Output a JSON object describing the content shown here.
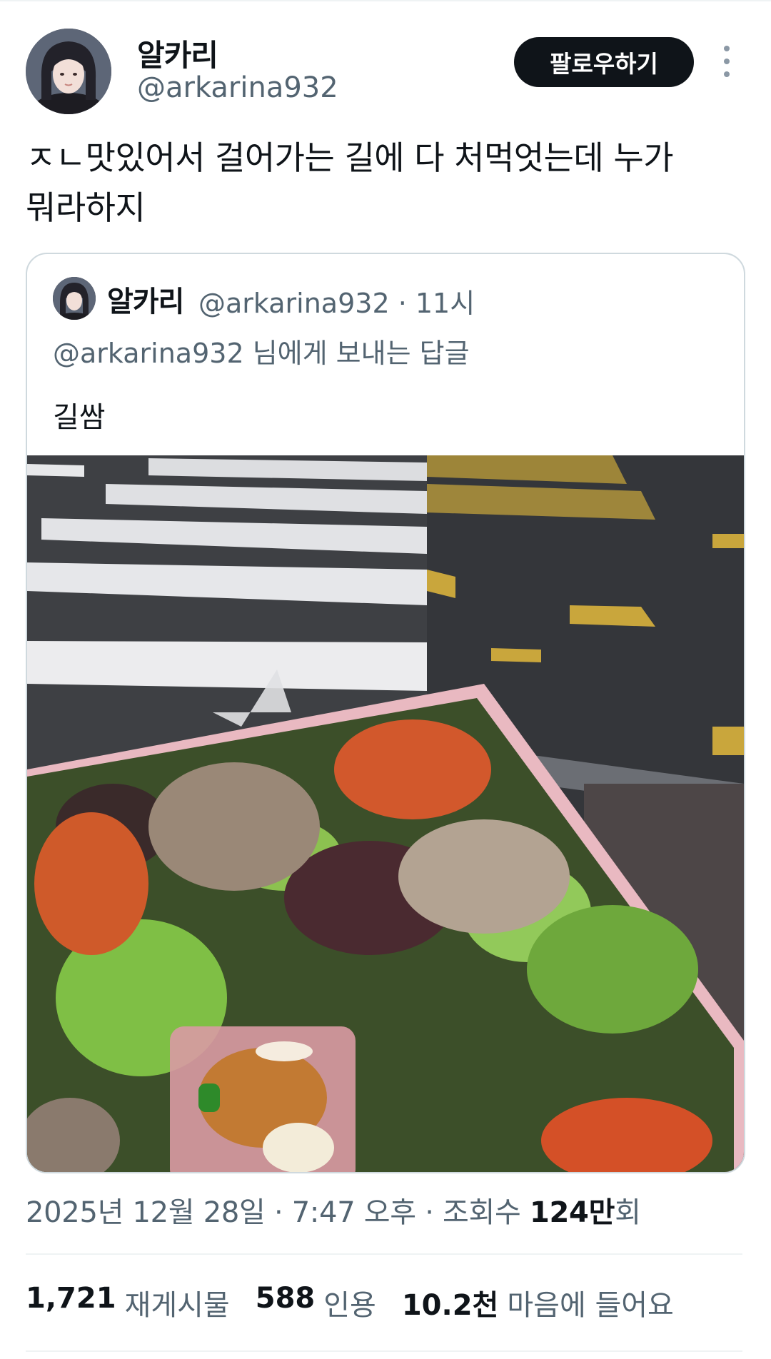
{
  "author": {
    "display_name": "알카리",
    "handle": "@arkarina932"
  },
  "follow_button": "팔로우하기",
  "more_icon": "more-vertical-icon",
  "tweet": {
    "text": "ㅈㄴ맛있어서 걸어가는 길에 다 처먹엇는데 누가\n뭐라하지"
  },
  "quote": {
    "display_name": "알카리",
    "meta": "@arkarina932 · 11시",
    "reply_to": "@arkarina932 님에게 보내는 답글",
    "text": "길쌈"
  },
  "meta": {
    "date_time": "2025년 12월 28일 · 7:47 오후 · 조회수 ",
    "views": "124만",
    "views_suffix": "회"
  },
  "stats": {
    "retweets_count": "1,721",
    "retweets_label": "재게시물",
    "quotes_count": "588",
    "quotes_label": "인용",
    "likes_count": "10.2천",
    "likes_label": "마음에 들어요"
  }
}
